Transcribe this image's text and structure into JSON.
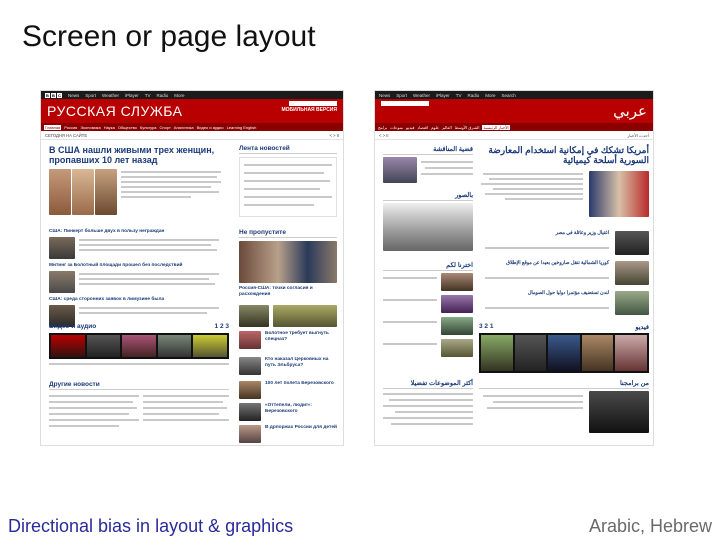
{
  "slide": {
    "title": "Screen or page layout",
    "caption_left": "Directional bias in layout & graphics",
    "caption_right": "Arabic, Hebrew"
  },
  "russian_page": {
    "bbc_letters": [
      "B",
      "B",
      "C"
    ],
    "nav_top": [
      "News",
      "Sport",
      "Weather",
      "iPlayer",
      "TV",
      "Radio",
      "More"
    ],
    "search_label": "Search",
    "brand": "РУССКАЯ СЛУЖБА",
    "mobile_label": "МОБИЛЬНАЯ ВЕРСИЯ",
    "menu": [
      "Главная",
      "Россия",
      "Экономика",
      "Наука",
      "Общество",
      "Культура",
      "Спорт",
      "Аналитика",
      "Видео и аудио",
      "Learning English"
    ],
    "strip_left": "СЕГОДНЯ НА САЙТЕ",
    "strip_right": "< > II",
    "lead_headline": "В США нашли живыми трех женщин, пропавших 10 лет назад",
    "feed_title": "Лента новостей",
    "story_2": "США: Пинкерт больше двух в пользу неграждан",
    "story_3": "Митинг за Болотный площади прошел без последствий",
    "story_4": "США: среда сторонних заявок в лимузине была",
    "miss_title": "Не пропустите",
    "miss_caption": "Россия-США: точки согласия и расхождения",
    "video_title": "Видео и аудио",
    "video_pages": "1 2 3",
    "other_title": "Другие новости",
    "side_links": [
      "Болотное требует выгнуть спецназ?",
      "Кто наказал Церковных на путь Эльбруса?",
      "100 лет полета Березовского",
      "«Оттепели, люди!»: Березовского",
      "В дрпоржах России для детей"
    ]
  },
  "arabic_page": {
    "brand": "عربي",
    "nav_top": [
      "News",
      "Sport",
      "Weather",
      "iPlayer",
      "TV",
      "Radio",
      "More"
    ],
    "search_label": "Search",
    "menu": [
      "الأخبار الرئيسية",
      "الشرق الأوسط",
      "العالم",
      "علوم",
      "اقتصاد",
      "فيديو",
      "منوعات",
      "برامج"
    ],
    "strip_right": "أحدث الأخبار",
    "lead_headline": "أمريكا تشكك في إمكانية استخدام المعارضة السورية أسلحة كيميائية",
    "case_title": "قضية المناقشة",
    "photos_title": "بالصور",
    "choose_title": "اخترنا لكم",
    "video_title": "فيديو",
    "video_pages": "3 2 1",
    "topics_title": "أكثر الموضوعات تفضيلا",
    "programs_title": "من برامجنا",
    "mid_links": [
      "اغتيال وزير وعائلة في مصر",
      "كوريا الشمالية تنقل صاروخين بعيدا عن موقع الإطلاق",
      "لندن تستضيف مؤتمرا دوليا حول الصومال"
    ]
  },
  "colors": {
    "bbc_red": "#b80000",
    "bbc_dark_red": "#8a0000",
    "link_blue": "#1a3a7a",
    "caption_blue": "#2a2a9a",
    "caption_gray": "#6a6a6a"
  }
}
